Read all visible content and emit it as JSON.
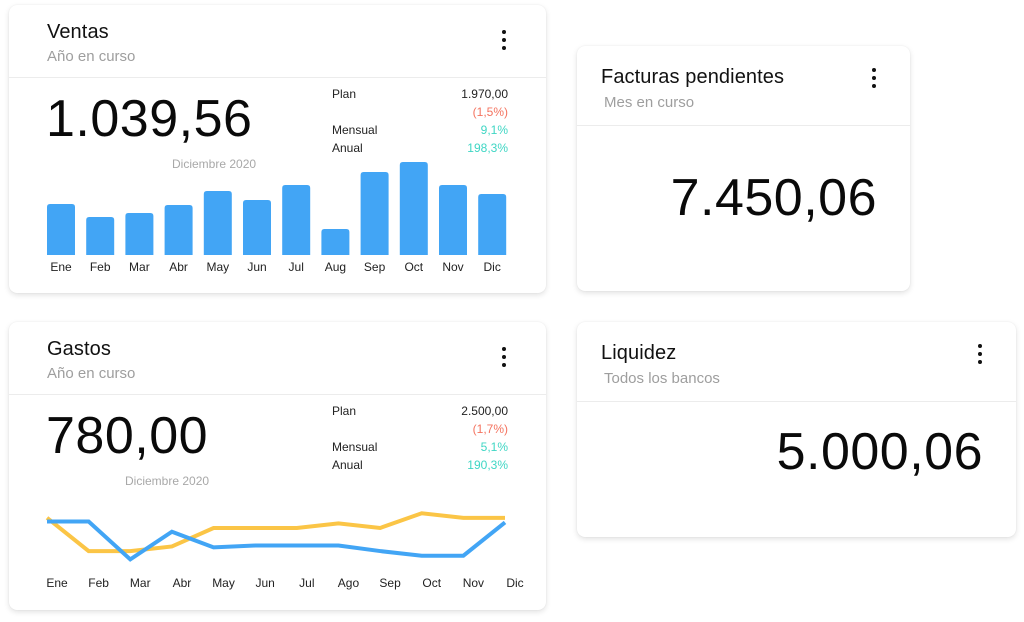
{
  "colors": {
    "bar": "#42a5f5",
    "line_blue": "#42a5f5",
    "line_yellow": "#fbc546",
    "negative": "#f4735f",
    "positive": "#3fd6c4"
  },
  "cards": {
    "ventas": {
      "title": "Ventas",
      "subtitle": "Año en curso",
      "value": "1.039,56",
      "period": "Diciembre 2020",
      "menu_icon": "more-vertical-icon",
      "stats": {
        "plan_label": "Plan",
        "plan_value": "1.970,00",
        "plan_diff": "(1,5%)",
        "mensual_label": "Mensual",
        "mensual_value": "9,1%",
        "anual_label": "Anual",
        "anual_value": "198,3%"
      }
    },
    "gastos": {
      "title": "Gastos",
      "subtitle": "Año en curso",
      "value": "780,00",
      "period": "Diciembre 2020",
      "menu_icon": "more-vertical-icon",
      "stats": {
        "plan_label": "Plan",
        "plan_value": "2.500,00",
        "plan_diff": "(1,7%)",
        "mensual_label": "Mensual",
        "mensual_value": "5,1%",
        "anual_label": "Anual",
        "anual_value": "190,3%"
      }
    },
    "facturas": {
      "title": "Facturas pendientes",
      "subtitle": "Mes en curso",
      "value": "7.450,06",
      "menu_icon": "more-vertical-icon"
    },
    "liquidez": {
      "title": "Liquidez",
      "subtitle": "Todos los bancos",
      "value": "5.000,06",
      "menu_icon": "more-vertical-icon"
    }
  },
  "chart_data": [
    {
      "type": "bar",
      "title": "Ventas",
      "categories": [
        "Ene",
        "Feb",
        "Mar",
        "Abr",
        "May",
        "Jun",
        "Jul",
        "Aug",
        "Sep",
        "Oct",
        "Nov",
        "Dic"
      ],
      "values": [
        51,
        38,
        42,
        50,
        64,
        55,
        70,
        26,
        83,
        93,
        70,
        61
      ],
      "ylim": [
        0,
        100
      ],
      "grid": false,
      "xlabel": "",
      "ylabel": ""
    },
    {
      "type": "line",
      "title": "Gastos",
      "categories": [
        "Ene",
        "Feb",
        "Mar",
        "Abr",
        "May",
        "Jun",
        "Jul",
        "Ago",
        "Sep",
        "Oct",
        "Nov",
        "Dic"
      ],
      "series": [
        {
          "name": "yellow",
          "values": [
            50,
            14,
            14,
            19,
            39,
            39,
            39,
            44,
            39,
            55,
            50,
            50
          ]
        },
        {
          "name": "blue",
          "values": [
            46,
            46,
            5,
            35,
            18,
            20,
            20,
            20,
            14,
            9,
            9,
            45
          ]
        }
      ],
      "ylim": [
        0,
        65
      ],
      "grid": false,
      "xlabel": "",
      "ylabel": ""
    }
  ]
}
